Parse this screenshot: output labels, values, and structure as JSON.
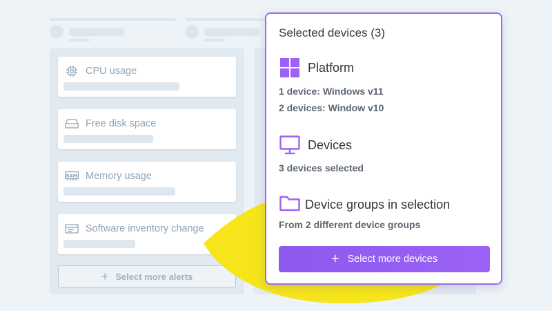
{
  "alerts": {
    "items": [
      {
        "label": "CPU usage",
        "icon": "cpu-icon"
      },
      {
        "label": "Free disk space",
        "icon": "disk-icon"
      },
      {
        "label": "Memory usage",
        "icon": "ram-icon"
      },
      {
        "label": "Software inventory change",
        "icon": "window-icon"
      }
    ],
    "ram_icon_text": "RAM",
    "select_more_label": "Select more alerts"
  },
  "popover": {
    "title": "Selected devices (3)",
    "platform": {
      "heading": "Platform",
      "icon": "windows-icon",
      "lines": [
        "1 device: Windows v11",
        "2 devices: Window v10"
      ]
    },
    "devices": {
      "heading": "Devices",
      "icon": "monitor-icon",
      "summary": "3 devices selected"
    },
    "groups": {
      "heading": "Device groups in selection",
      "icon": "folder-icon",
      "summary": "From 2 different device groups"
    },
    "select_more_label": "Select more devices"
  },
  "colors": {
    "accent": "#9b62f5",
    "accent_border": "#9b6cf0",
    "swoosh": "#f6e51a",
    "muted_text": "#8fa3b5"
  }
}
